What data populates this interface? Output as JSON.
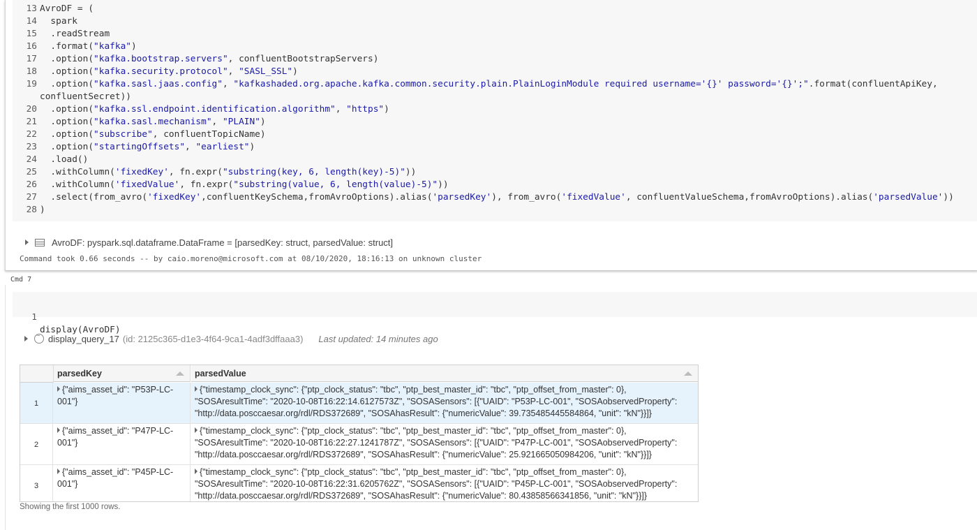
{
  "cell1": {
    "code_lines": [
      {
        "n": "13",
        "segs": [
          {
            "t": "AvroDF = (",
            "c": ""
          }
        ]
      },
      {
        "n": "14",
        "segs": [
          {
            "t": "  spark",
            "c": ""
          }
        ]
      },
      {
        "n": "15",
        "segs": [
          {
            "t": "  .readStream",
            "c": ""
          }
        ]
      },
      {
        "n": "16",
        "segs": [
          {
            "t": "  .format(",
            "c": ""
          },
          {
            "t": "\"kafka\"",
            "c": "s1"
          },
          {
            "t": ")",
            "c": ""
          }
        ]
      },
      {
        "n": "17",
        "segs": [
          {
            "t": "  .option(",
            "c": ""
          },
          {
            "t": "\"kafka.bootstrap.servers\"",
            "c": "s1"
          },
          {
            "t": ", confluentBootstrapServers)",
            "c": ""
          }
        ]
      },
      {
        "n": "18",
        "segs": [
          {
            "t": "  .option(",
            "c": ""
          },
          {
            "t": "\"kafka.security.protocol\"",
            "c": "s1"
          },
          {
            "t": ", ",
            "c": ""
          },
          {
            "t": "\"SASL_SSL\"",
            "c": "s1"
          },
          {
            "t": ")",
            "c": ""
          }
        ]
      },
      {
        "n": "19",
        "segs": [
          {
            "t": "  .option(",
            "c": ""
          },
          {
            "t": "\"kafka.sasl.jaas.config\"",
            "c": "s1"
          },
          {
            "t": ", ",
            "c": ""
          },
          {
            "t": "\"kafkashaded.org.apache.kafka.common.security.plain.PlainLoginModule required username='{}' password='{}';\"",
            "c": "s1"
          },
          {
            "t": ".format(confluentApiKey,",
            "c": ""
          }
        ]
      },
      {
        "n": "",
        "segs": [
          {
            "t": "confluentSecret))",
            "c": ""
          }
        ]
      },
      {
        "n": "20",
        "segs": [
          {
            "t": "  .option(",
            "c": ""
          },
          {
            "t": "\"kafka.ssl.endpoint.identification.algorithm\"",
            "c": "s1"
          },
          {
            "t": ", ",
            "c": ""
          },
          {
            "t": "\"https\"",
            "c": "s1"
          },
          {
            "t": ")",
            "c": ""
          }
        ]
      },
      {
        "n": "21",
        "segs": [
          {
            "t": "  .option(",
            "c": ""
          },
          {
            "t": "\"kafka.sasl.mechanism\"",
            "c": "s1"
          },
          {
            "t": ", ",
            "c": ""
          },
          {
            "t": "\"PLAIN\"",
            "c": "s1"
          },
          {
            "t": ")",
            "c": ""
          }
        ]
      },
      {
        "n": "22",
        "segs": [
          {
            "t": "  .option(",
            "c": ""
          },
          {
            "t": "\"subscribe\"",
            "c": "s1"
          },
          {
            "t": ", confluentTopicName)",
            "c": ""
          }
        ]
      },
      {
        "n": "23",
        "segs": [
          {
            "t": "  .option(",
            "c": ""
          },
          {
            "t": "\"startingOffsets\"",
            "c": "s1"
          },
          {
            "t": ", ",
            "c": ""
          },
          {
            "t": "\"earliest\"",
            "c": "s1"
          },
          {
            "t": ")",
            "c": ""
          }
        ]
      },
      {
        "n": "24",
        "segs": [
          {
            "t": "  .load()",
            "c": ""
          }
        ]
      },
      {
        "n": "25",
        "segs": [
          {
            "t": "  .withColumn(",
            "c": ""
          },
          {
            "t": "'fixedKey'",
            "c": "s1"
          },
          {
            "t": ", fn.expr(",
            "c": ""
          },
          {
            "t": "\"substring(key, 6, length(key)-5)\"",
            "c": "s1"
          },
          {
            "t": "))",
            "c": ""
          }
        ]
      },
      {
        "n": "26",
        "segs": [
          {
            "t": "  .withColumn(",
            "c": ""
          },
          {
            "t": "'fixedValue'",
            "c": "s1"
          },
          {
            "t": ", fn.expr(",
            "c": ""
          },
          {
            "t": "\"substring(value, 6, length(value)-5)\"",
            "c": "s1"
          },
          {
            "t": "))",
            "c": ""
          }
        ]
      },
      {
        "n": "27",
        "segs": [
          {
            "t": "  .select(from_avro(",
            "c": ""
          },
          {
            "t": "'fixedKey'",
            "c": "s1"
          },
          {
            "t": ",confluentKeySchema,fromAvroOptions).alias(",
            "c": ""
          },
          {
            "t": "'parsedKey'",
            "c": "s1"
          },
          {
            "t": "), from_avro(",
            "c": ""
          },
          {
            "t": "'fixedValue'",
            "c": "s1"
          },
          {
            "t": ", confluentValueSchema,fromAvroOptions).alias(",
            "c": ""
          },
          {
            "t": "'parsedValue'",
            "c": "s1"
          },
          {
            "t": "))",
            "c": ""
          }
        ]
      },
      {
        "n": "28",
        "segs": [
          {
            "t": ")",
            "c": ""
          }
        ]
      }
    ],
    "output_text": "AvroDF:  pyspark.sql.dataframe.DataFrame = [parsedKey: struct, parsedValue: struct]",
    "command_took": "Command took 0.66 seconds -- by caio.moreno@microsoft.com at 08/10/2020, 18:16:13 on unknown cluster"
  },
  "cmd_label": "Cmd 7",
  "cell2": {
    "line_no": "1",
    "code": "display(AvroDF)",
    "query_name": "display_query_17",
    "query_id": "(id: 2125c365-d1e3-4f64-9ca1-4adf3dffaaa3)",
    "last_updated": "Last updated: 14 minutes ago",
    "table": {
      "columns": [
        "parsedKey",
        "parsedValue"
      ],
      "rows": [
        {
          "idx": "1",
          "key": "{\"aims_asset_id\": \"P53P-LC-001\"}",
          "value": "{\"timestamp_clock_sync\": {\"ptp_clock_status\": \"tbc\", \"ptp_best_master_id\": \"tbc\", \"ptp_offset_from_master\": 0}, \"SOSAresultTime\": \"2020-10-08T16:22:14.6127573Z\", \"SOSASensors\": [{\"UAID\": \"P53P-LC-001\", \"SOSAobservedProperty\": \"http://data.posccaesar.org/rdl/RDS372689\", \"SOSAhasResult\": {\"numericValue\": 39.735485445584864, \"unit\": \"kN\"}}]}"
        },
        {
          "idx": "2",
          "key": "{\"aims_asset_id\": \"P47P-LC-001\"}",
          "value": "{\"timestamp_clock_sync\": {\"ptp_clock_status\": \"tbc\", \"ptp_best_master_id\": \"tbc\", \"ptp_offset_from_master\": 0}, \"SOSAresultTime\": \"2020-10-08T16:22:27.1241787Z\", \"SOSASensors\": [{\"UAID\": \"P47P-LC-001\", \"SOSAobservedProperty\": \"http://data.posccaesar.org/rdl/RDS372689\", \"SOSAhasResult\": {\"numericValue\": 25.921665050984206, \"unit\": \"kN\"}}]}"
        },
        {
          "idx": "3",
          "key": "{\"aims_asset_id\": \"P45P-LC-001\"}",
          "value": "{\"timestamp_clock_sync\": {\"ptp_clock_status\": \"tbc\", \"ptp_best_master_id\": \"tbc\", \"ptp_offset_from_master\": 0}, \"SOSAresultTime\": \"2020-10-08T16:22:31.6205762Z\", \"SOSASensors\": [{\"UAID\": \"P45P-LC-001\", \"SOSAobservedProperty\": \"http://data.posccaesar.org/rdl/RDS372689\", \"SOSAhasResult\": {\"numericValue\": 80.43858566341856, \"unit\": \"kN\"}}]}"
        }
      ]
    },
    "showing": "Showing the first 1000 rows."
  },
  "colors": {
    "string": "#1a1aa6",
    "selected_row": "#e6f2fc",
    "code_bg": "#f7f7f7"
  }
}
